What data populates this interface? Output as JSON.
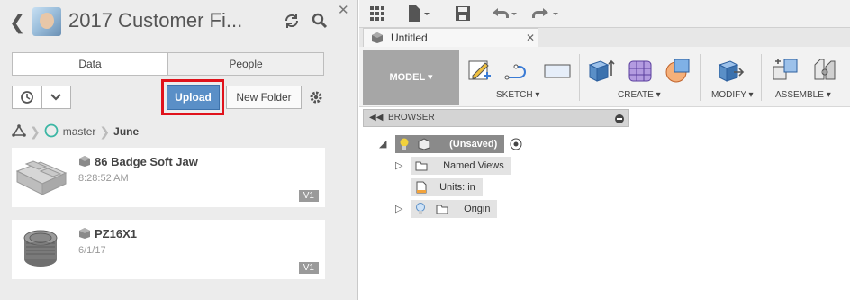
{
  "project_panel": {
    "title": "2017 Customer Fi...",
    "tabs": [
      "Data",
      "People"
    ],
    "upload_label": "Upload",
    "new_folder_label": "New Folder",
    "breadcrumb": {
      "branch": "master",
      "folder": "June"
    },
    "items": [
      {
        "name": "86 Badge Soft Jaw",
        "meta": "8:28:52 AM",
        "version": "V1"
      },
      {
        "name": "PZ16X1",
        "meta": "6/1/17",
        "version": "V1"
      }
    ]
  },
  "workspace": {
    "doc_tab": "Untitled",
    "model_label": "MODEL",
    "groups": {
      "sketch": "SKETCH",
      "create": "CREATE",
      "modify": "MODIFY",
      "assemble": "ASSEMBLE"
    },
    "browser_label": "BROWSER",
    "tree": {
      "root": "(Unsaved)",
      "named_views": "Named Views",
      "units": "Units: in",
      "origin": "Origin"
    }
  },
  "colors": {
    "upload": "#5a8fc7",
    "highlight": "#e0121b",
    "model": "#a6a6a6"
  }
}
